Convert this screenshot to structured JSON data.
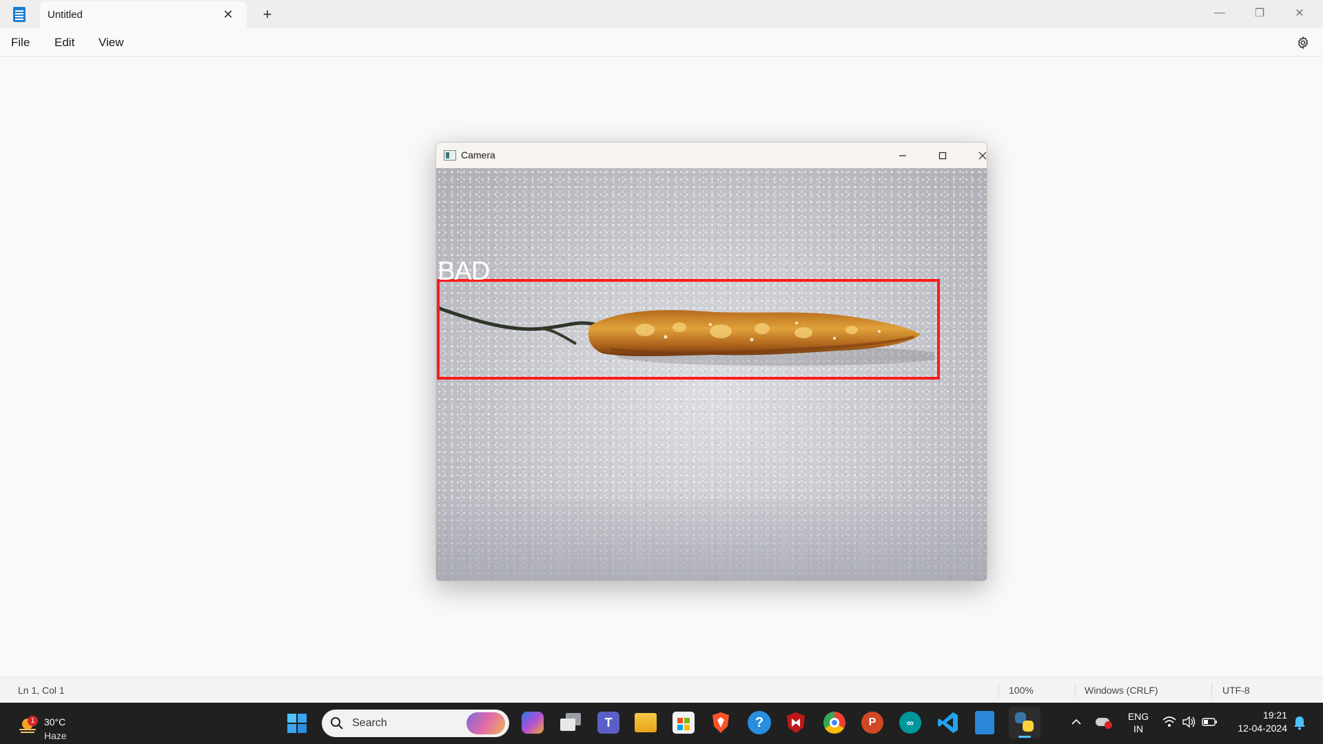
{
  "notepad": {
    "tab_title": "Untitled",
    "tab_close": "✕",
    "new_tab": "+",
    "window_controls": {
      "minimize": "—",
      "restore": "❐",
      "close": "✕"
    },
    "menu": [
      "File",
      "Edit",
      "View"
    ],
    "status": {
      "position": "Ln 1, Col 1",
      "zoom": "100%",
      "line_ending": "Windows (CRLF)",
      "encoding": "UTF-8"
    }
  },
  "camera_window": {
    "title": "Camera",
    "detection_label": "BAD",
    "detection_box_color": "#ff1a1a"
  },
  "taskbar": {
    "weather": {
      "temp": "30°C",
      "condition": "Haze",
      "badge": "1"
    },
    "search_placeholder": "Search",
    "apps": [
      "copilot-pre-icon",
      "task-view-icon",
      "teams-icon",
      "file-explorer-icon",
      "microsoft-store-icon",
      "brave-icon",
      "help-icon",
      "mcafee-icon",
      "chrome-icon",
      "powerpoint-icon",
      "arduino-icon",
      "vscode-icon",
      "notepad-icon",
      "python-icon"
    ],
    "language": {
      "line1": "ENG",
      "line2": "IN"
    },
    "time": "19:21",
    "date": "12-04-2024"
  }
}
